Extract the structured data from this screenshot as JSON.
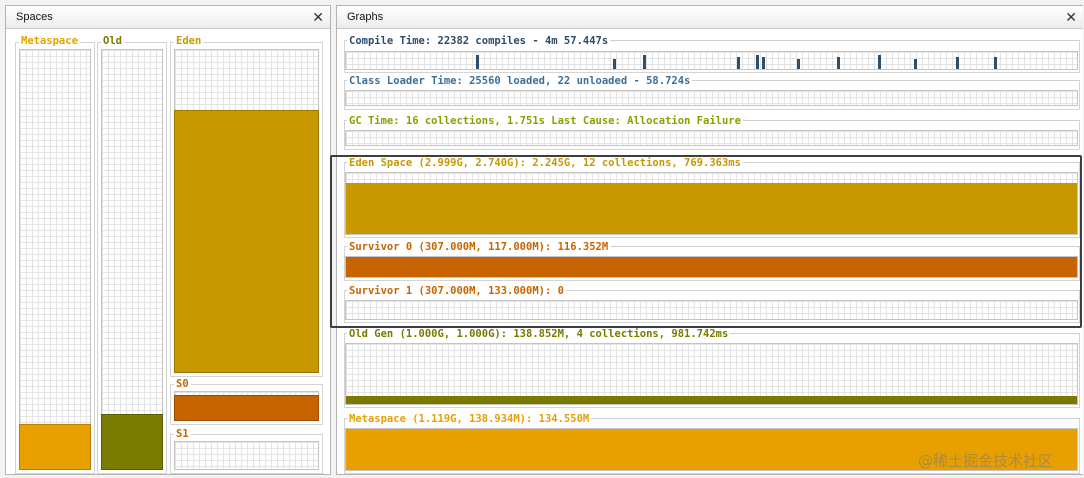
{
  "spaces_panel": {
    "title": "Spaces",
    "close": "✕"
  },
  "graphs_panel": {
    "title": "Graphs",
    "close": "✕"
  },
  "spaces": [
    {
      "label": "Metaspace",
      "color": "#e8a000",
      "fill": 0.12
    },
    {
      "label": "Old",
      "color": "#7a7a00",
      "fill": 0.14
    },
    {
      "label": "Eden",
      "color": "#c89800",
      "fill": 0.82
    },
    {
      "label": "S0",
      "color": "#c86400",
      "fill": 0.94
    },
    {
      "label": "S1",
      "color": "#c86400",
      "fill": 0.0
    }
  ],
  "graphs": {
    "compile": {
      "text": "Compile Time: 22382 compiles - 4m 57.447s",
      "color": "#2b4d6b"
    },
    "classloader": {
      "text": "Class Loader Time: 25560 loaded, 22 unloaded - 58.724s",
      "color": "#3a6f9a"
    },
    "gc": {
      "text": "GC Time: 16 collections, 1.751s  Last Cause: Allocation Failure",
      "color": "#8aa000"
    },
    "eden": {
      "text": "Eden Space (2.999G, 2.740G): 2.245G, 12 collections, 769.363ms",
      "color": "#c89800"
    },
    "survivor0": {
      "text": "Survivor 0 (307.000M, 117.000M): 116.352M",
      "color": "#c86400"
    },
    "survivor1": {
      "text": "Survivor 1 (307.000M, 133.000M): 0",
      "color": "#c86400"
    },
    "oldgen": {
      "text": "Old Gen (1.000G, 1.000G): 138.852M, 4 collections, 981.742ms",
      "color": "#7a7a00"
    },
    "metaspace": {
      "text": "Metaspace (1.119G, 138.934M): 134.550M",
      "color": "#e8a000"
    }
  },
  "watermark": "@稀土掘金技术社区"
}
